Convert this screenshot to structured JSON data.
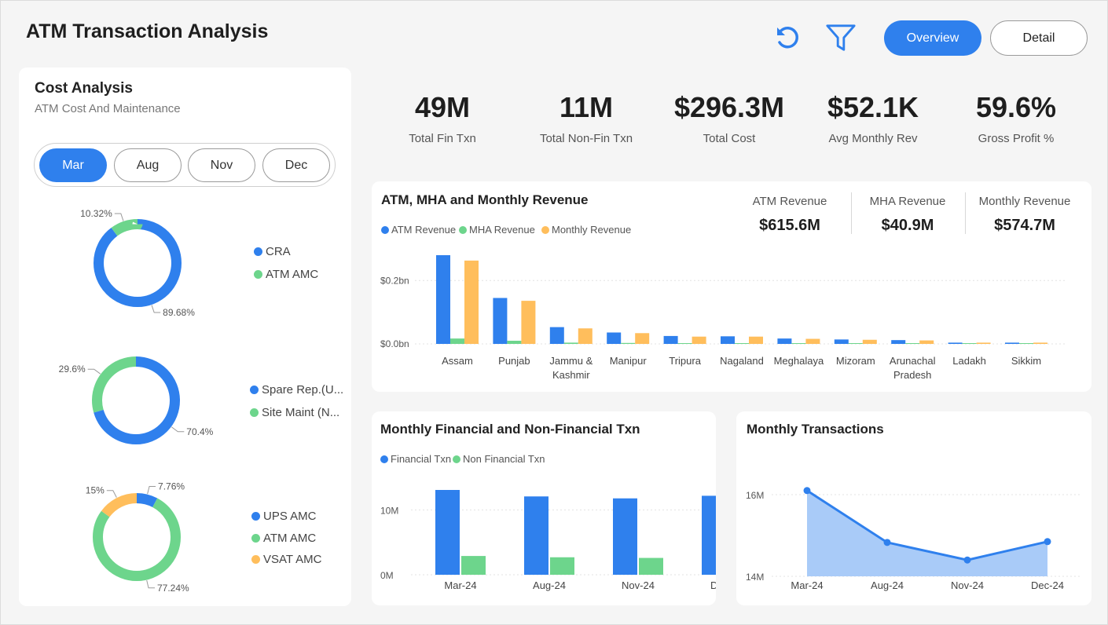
{
  "header": {
    "title": "ATM Transaction Analysis",
    "overview_label": "Overview",
    "detail_label": "Detail",
    "refresh_icon": "refresh-icon",
    "filter_icon": "filter-icon"
  },
  "colors": {
    "blue": "#2f80ed",
    "green": "#6dd58c",
    "orange": "#ffbe5c",
    "area": "#a9cbf8"
  },
  "cost": {
    "title": "Cost Analysis",
    "subtitle": "ATM Cost And Maintenance",
    "months": [
      "Mar",
      "Aug",
      "Nov",
      "Dec"
    ],
    "selected_month": "Mar",
    "donuts": [
      {
        "slices": [
          {
            "label": "CRA",
            "pct": 89.68,
            "pct_label": "89.68%"
          },
          {
            "label": "ATM AMC",
            "pct": 10.32,
            "pct_label": "10.32%"
          }
        ]
      },
      {
        "slices": [
          {
            "label": "Spare Rep.(U...",
            "pct": 70.4,
            "pct_label": "70.4%"
          },
          {
            "label": "Site Maint (N...",
            "pct": 29.6,
            "pct_label": "29.6%"
          }
        ]
      },
      {
        "slices": [
          {
            "label": "UPS AMC",
            "pct": 7.76,
            "pct_label": "7.76%"
          },
          {
            "label": "ATM AMC",
            "pct": 77.24,
            "pct_label": "77.24%"
          },
          {
            "label": "VSAT AMC",
            "pct": 15,
            "pct_label": "15%"
          }
        ]
      }
    ]
  },
  "kpis": [
    {
      "value": "49M",
      "label": "Total Fin Txn"
    },
    {
      "value": "11M",
      "label": "Total Non-Fin Txn"
    },
    {
      "value": "$296.3M",
      "label": "Total Cost"
    },
    {
      "value": "$52.1K",
      "label": "Avg Monthly Rev"
    },
    {
      "value": "59.6%",
      "label": "Gross Profit %"
    }
  ],
  "revenue": {
    "title": "ATM, MHA and Monthly Revenue",
    "legend": [
      "ATM Revenue",
      "MHA Revenue",
      "Monthly Revenue"
    ],
    "kpis": [
      {
        "label": "ATM Revenue",
        "value": "$615.6M"
      },
      {
        "label": "MHA Revenue",
        "value": "$40.9M"
      },
      {
        "label": "Monthly Revenue",
        "value": "$574.7M"
      }
    ]
  },
  "fin": {
    "title": "Monthly Financial and Non-Financial Txn",
    "legend": [
      "Financial Txn",
      "Non Financial Txn"
    ]
  },
  "trans": {
    "title": "Monthly Transactions"
  },
  "chart_data": [
    {
      "type": "bar",
      "title": "ATM, MHA and Monthly Revenue",
      "categories": [
        "Assam",
        "Punjab",
        "Jammu & Kashmir",
        "Manipur",
        "Tripura",
        "Nagaland",
        "Meghalaya",
        "Mizoram",
        "Arunachal Pradesh",
        "Ladakh",
        "Sikkim"
      ],
      "category_lines": [
        [
          "Assam"
        ],
        [
          "Punjab"
        ],
        [
          "Jammu &",
          "Kashmir"
        ],
        [
          "Manipur"
        ],
        [
          "Tripura"
        ],
        [
          "Nagaland"
        ],
        [
          "Meghalaya"
        ],
        [
          "Mizoram"
        ],
        [
          "Arunachal",
          "Pradesh"
        ],
        [
          "Ladakh"
        ],
        [
          "Sikkim"
        ]
      ],
      "series": [
        {
          "name": "ATM Revenue",
          "values": [
            0.28,
            0.145,
            0.053,
            0.036,
            0.025,
            0.024,
            0.017,
            0.014,
            0.012,
            0.004,
            0.004
          ]
        },
        {
          "name": "MHA Revenue",
          "values": [
            0.017,
            0.01,
            0.004,
            0.003,
            0.002,
            0.002,
            0.0015,
            0.001,
            0.001,
            0.0004,
            0.0004
          ]
        },
        {
          "name": "Monthly Revenue",
          "values": [
            0.263,
            0.136,
            0.049,
            0.034,
            0.023,
            0.023,
            0.016,
            0.013,
            0.011,
            0.004,
            0.004
          ]
        }
      ],
      "yticks": [
        0,
        0.2
      ],
      "ytick_labels": [
        "$0.0bn",
        "$0.2bn"
      ],
      "ylim": [
        0,
        0.28
      ],
      "legend_position": "top-left"
    },
    {
      "type": "bar",
      "title": "Monthly Financial and Non-Financial Txn",
      "categories": [
        "Mar-24",
        "Aug-24",
        "Nov-24",
        "Dec-24"
      ],
      "series": [
        {
          "name": "Financial Txn",
          "values": [
            13.1,
            12.1,
            11.8,
            12.2
          ]
        },
        {
          "name": "Non Financial Txn",
          "values": [
            2.9,
            2.7,
            2.6,
            2.7
          ]
        }
      ],
      "yticks": [
        0,
        10
      ],
      "ytick_labels": [
        "0M",
        "10M"
      ],
      "ylim": [
        0,
        13.1
      ],
      "legend_position": "top-left"
    },
    {
      "type": "area",
      "title": "Monthly Transactions",
      "categories": [
        "Mar-24",
        "Aug-24",
        "Nov-24",
        "Dec-24"
      ],
      "values": [
        16.1,
        14.83,
        14.4,
        14.85
      ],
      "yticks": [
        14,
        16
      ],
      "ytick_labels": [
        "14M",
        "16M"
      ],
      "ylim": [
        14,
        16
      ]
    }
  ]
}
